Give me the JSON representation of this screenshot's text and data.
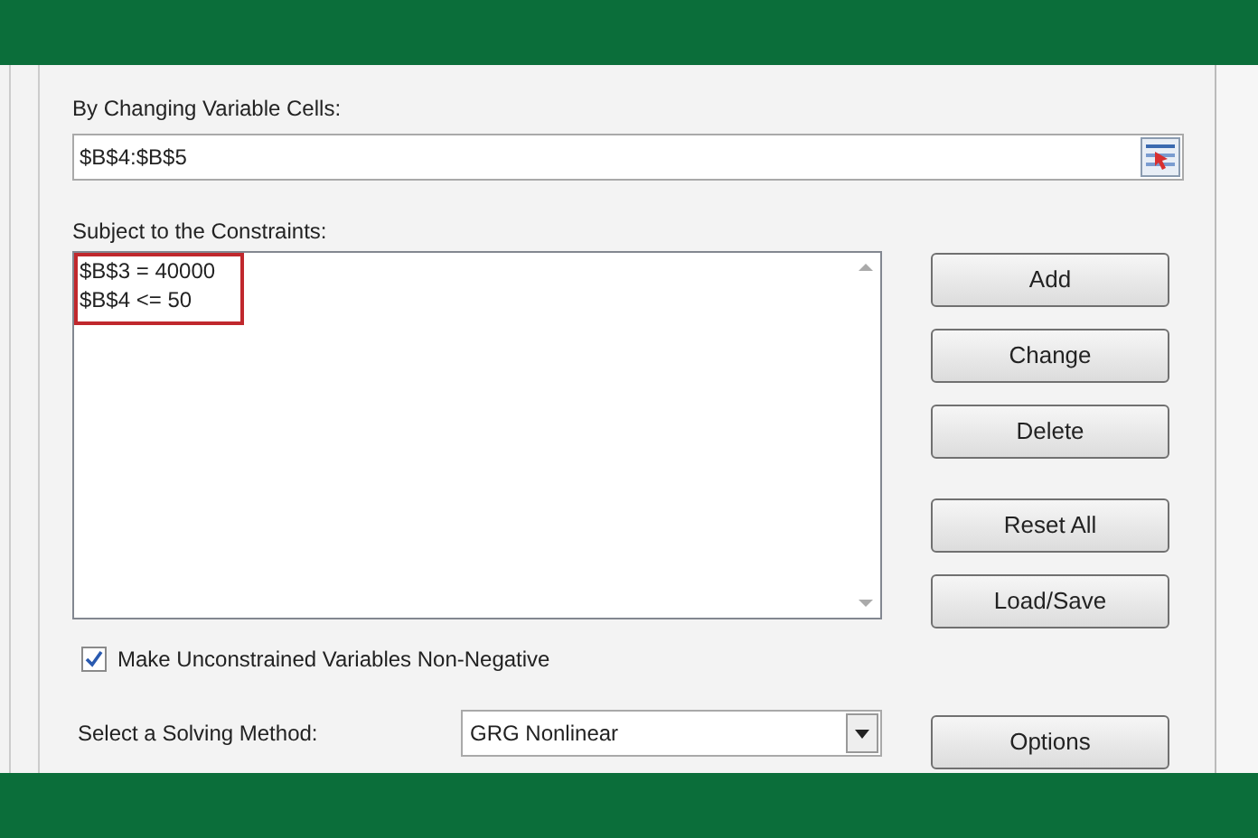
{
  "changing_cells": {
    "label": "By Changing Variable Cells:",
    "value": "$B$4:$B$5"
  },
  "constraints": {
    "label": "Subject to the Constraints:",
    "items": [
      {
        "text": "$B$3 = 40000",
        "highlighted": true
      },
      {
        "text": "$B$4 <= 50",
        "highlighted": true
      }
    ]
  },
  "buttons": [
    {
      "label": "Add"
    },
    {
      "label": "Change"
    },
    {
      "label": "Delete"
    },
    {
      "label": "Reset All"
    },
    {
      "label": "Load/Save"
    }
  ],
  "non_negative": {
    "label": "Make Unconstrained Variables Non-Negative",
    "checked": true
  },
  "method": {
    "label": "Select a Solving Method:",
    "value": "GRG Nonlinear"
  },
  "options_button": {
    "label": "Options"
  }
}
